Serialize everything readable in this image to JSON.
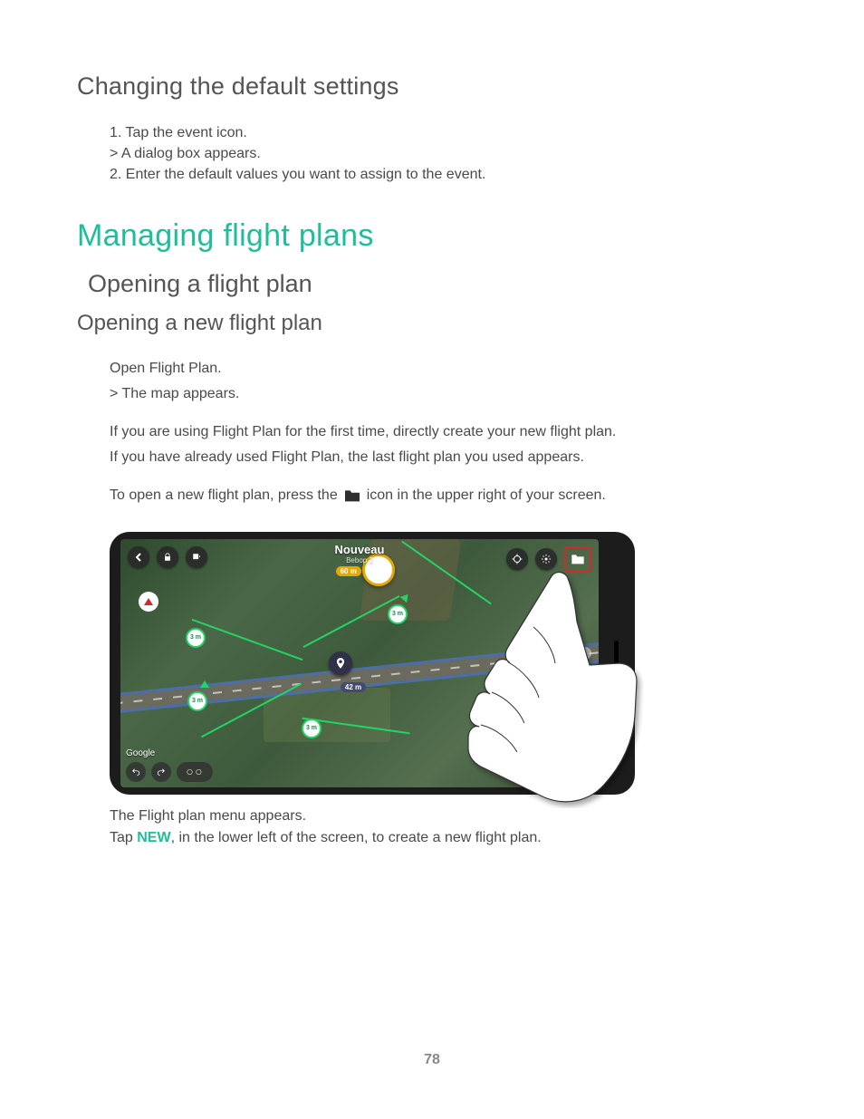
{
  "section1": {
    "heading": "Changing the default settings",
    "step1": "1. Tap the event icon.",
    "step_note": "> A dialog box appears.",
    "step2": "2. Enter the default values you want to assign to the event."
  },
  "major_heading": "Managing flight plans",
  "sub_heading": "Opening a flight plan",
  "sub_heading2": "Opening a new flight plan",
  "body": {
    "p1": "Open Flight Plan.",
    "p2": "> The map appears.",
    "p3": "If you are using Flight Plan for the first time, directly create your new flight plan.",
    "p4": "If you have already used Flight Plan, the last flight plan you used appears.",
    "p5_pre": "To open a new flight plan, press the",
    "p5_post": "icon in the upper right of your screen."
  },
  "app_screenshot": {
    "title": "Nouveau",
    "subtitle": "Bebop 2",
    "map_attribution": "Google",
    "altitude_badge": "60 m",
    "distance_badge": "42 m",
    "waypoint_label": "3 m"
  },
  "caption": {
    "line1": "The Flight plan menu appears.",
    "line2_pre": "Tap ",
    "line2_strong": "NEW",
    "line2_post": ", in the lower left of the screen, to create a new flight plan."
  },
  "page_number": "78"
}
